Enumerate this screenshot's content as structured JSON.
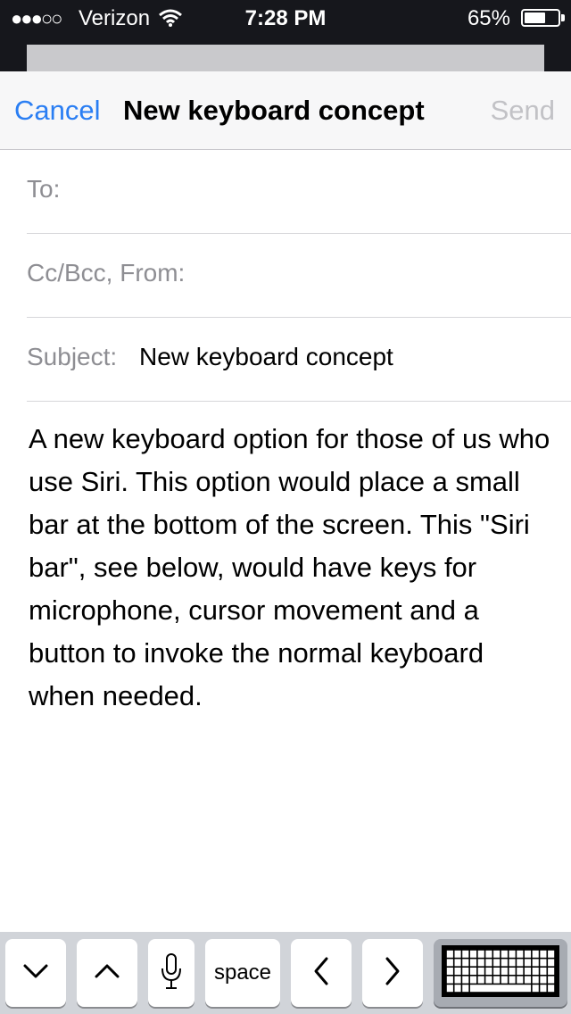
{
  "status_bar": {
    "signal_dots": "●●●○○",
    "carrier": "Verizon",
    "time": "7:28 PM",
    "battery_percent": "65%",
    "battery_level": 0.65
  },
  "navbar": {
    "cancel_label": "Cancel",
    "title": "New keyboard concept",
    "send_label": "Send"
  },
  "fields": {
    "to_label": "To:",
    "cc_label": "Cc/Bcc, From:",
    "subject_label": "Subject:",
    "subject_value": "New keyboard concept"
  },
  "body": {
    "text": "A new keyboard option for those of us who use Siri. This option would place a small bar at the bottom of the screen. This \"Siri bar\", see below, would have keys for microphone, cursor movement and a button to invoke the normal keyboard when needed."
  },
  "siri_bar": {
    "keys": [
      {
        "icon": "chevron-down-icon"
      },
      {
        "icon": "chevron-up-icon"
      },
      {
        "icon": "microphone-icon"
      },
      {
        "label": "space"
      },
      {
        "icon": "chevron-left-icon"
      },
      {
        "icon": "chevron-right-icon"
      },
      {
        "icon": "keyboard-icon"
      }
    ]
  },
  "colors": {
    "accent": "#2a7ef3",
    "status_bar_bg": "#16171c",
    "disabled": "#c2c2c6"
  }
}
